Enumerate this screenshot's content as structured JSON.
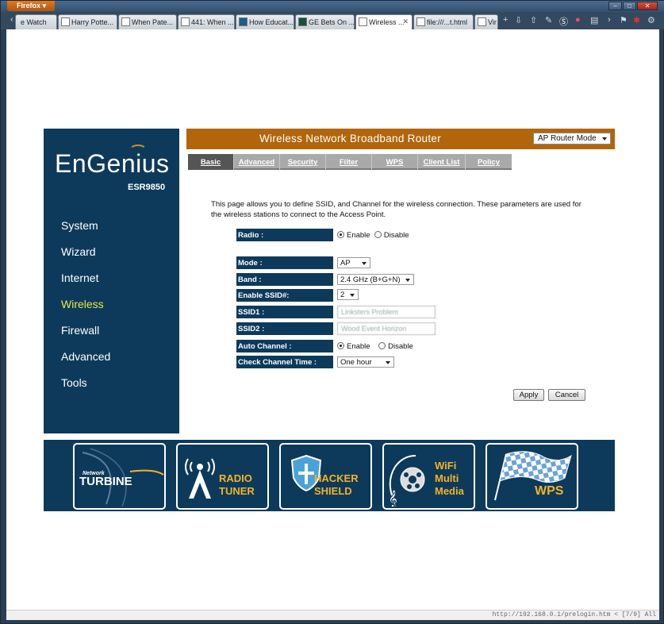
{
  "browser": {
    "app_menu": "Firefox",
    "tabs": [
      {
        "label": "e Watch"
      },
      {
        "label": "Harry Potte..."
      },
      {
        "label": "When Pate..."
      },
      {
        "label": "441: When ..."
      },
      {
        "label": "How Educat..."
      },
      {
        "label": "GE Bets On ..."
      },
      {
        "label": "Wireless ...",
        "active": true
      },
      {
        "label": "file:///...t.html"
      },
      {
        "label": "Vir"
      }
    ],
    "status_bar": "http://192.168.0.1/prelogin.htm < [7/9] All"
  },
  "router": {
    "brand": "EnGenius",
    "model": "ESR9850",
    "nav": [
      "System",
      "Wizard",
      "Internet",
      "Wireless",
      "Firewall",
      "Advanced",
      "Tools"
    ],
    "active_nav": "Wireless",
    "banner_title": "Wireless Network Broadband Router",
    "mode_select": "AP Router Mode",
    "subtabs": [
      "Basic",
      "Advanced",
      "Security",
      "Filter",
      "WPS",
      "Client List",
      "Policy"
    ],
    "active_subtab": "Basic",
    "description": "This page allows you to define SSID, and Channel for the wireless connection. These parameters are used for the wireless stations to connect to the Access Point.",
    "form": {
      "radio_label": "Radio :",
      "radio_enable": "Enable",
      "radio_disable": "Disable",
      "mode_label": "Mode :",
      "mode_value": "AP",
      "band_label": "Band :",
      "band_value": "2.4 GHz (B+G+N)",
      "enable_ssid_label": "Enable SSID#:",
      "enable_ssid_value": "2",
      "ssid1_label": "SSID1 :",
      "ssid1_value": "Linksters Problem",
      "ssid2_label": "SSID2 :",
      "ssid2_value": "Wood Event Horizon",
      "auto_channel_label": "Auto Channel :",
      "auto_enable": "Enable",
      "auto_disable": "Disable",
      "check_time_label": "Check Channel Time :",
      "check_time_value": "One hour"
    },
    "buttons": {
      "apply": "Apply",
      "cancel": "Cancel"
    },
    "features": [
      {
        "top": "Network",
        "main": "TURBINE"
      },
      {
        "top": "RADIO",
        "main": "TUNER"
      },
      {
        "top": "HACKER",
        "main": "SHIELD"
      },
      {
        "top": "WiFi",
        "mid": "Multi",
        "main": "Media"
      },
      {
        "main": "WPS"
      }
    ],
    "colors": {
      "navy": "#0d3a5b",
      "orange": "#b2650b",
      "highlight": "#e8e84c"
    }
  }
}
